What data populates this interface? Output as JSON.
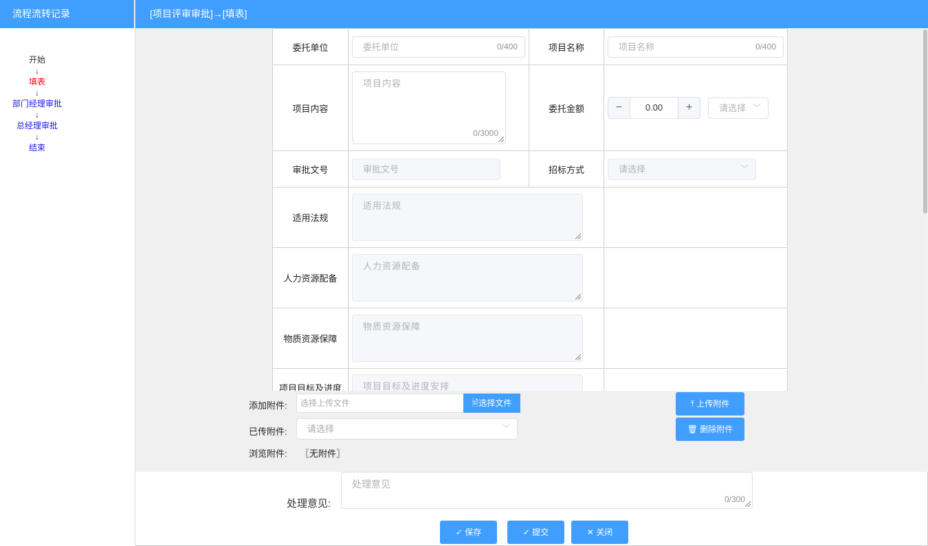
{
  "sidebar": {
    "title": "流程流转记录",
    "steps": [
      {
        "label": "开始",
        "state": "done"
      },
      {
        "label": "填表",
        "state": "current"
      },
      {
        "label": "部门经理审批",
        "state": "pending"
      },
      {
        "label": "总经理审批",
        "state": "pending"
      },
      {
        "label": "结束",
        "state": "pending"
      }
    ],
    "arrow": "↓"
  },
  "main": {
    "title": "[项目评审审批]→[填表]"
  },
  "form": {
    "client_unit": {
      "label": "委托单位",
      "placeholder": "委托单位",
      "count": "0/400"
    },
    "project_name": {
      "label": "项目名称",
      "placeholder": "项目名称",
      "count": "0/400"
    },
    "project_content": {
      "label": "项目内容",
      "placeholder": "项目内容",
      "count": "0/3000"
    },
    "amount": {
      "label": "委托金额",
      "value": "0.00",
      "minus": "−",
      "plus": "+",
      "unit_placeholder": "请选择"
    },
    "approval_no": {
      "label": "审批文号",
      "placeholder": "审批文号"
    },
    "bidding_method": {
      "label": "招标方式",
      "placeholder": "请选择"
    },
    "regulations": {
      "label": "适用法规",
      "placeholder": "适用法规"
    },
    "hr": {
      "label": "人力资源配备",
      "placeholder": "人力资源配备"
    },
    "material": {
      "label": "物质资源保障",
      "placeholder": "物质资源保障"
    },
    "goals": {
      "label": "项目目标及进度",
      "placeholder": "项目目标及进度安排"
    }
  },
  "attachments": {
    "add_label": "添加附件:",
    "file_placeholder": "选择上传文件",
    "choose_button": "选择文件",
    "uploaded_label": "已传附件:",
    "uploaded_placeholder": "请选择",
    "browse_label": "浏览附件:",
    "browse_value": "〖无附件〗",
    "upload_button": "上传附件",
    "delete_button": "删除附件"
  },
  "opinion": {
    "label": "处理意见:",
    "placeholder": "处理意见",
    "count": "0/300"
  },
  "actions": {
    "save": "保存",
    "submit": "提交",
    "close": "关闭"
  },
  "colors": {
    "accent": "#409eff",
    "current_step": "#ff0000",
    "pending_step": "#1a1aee"
  }
}
